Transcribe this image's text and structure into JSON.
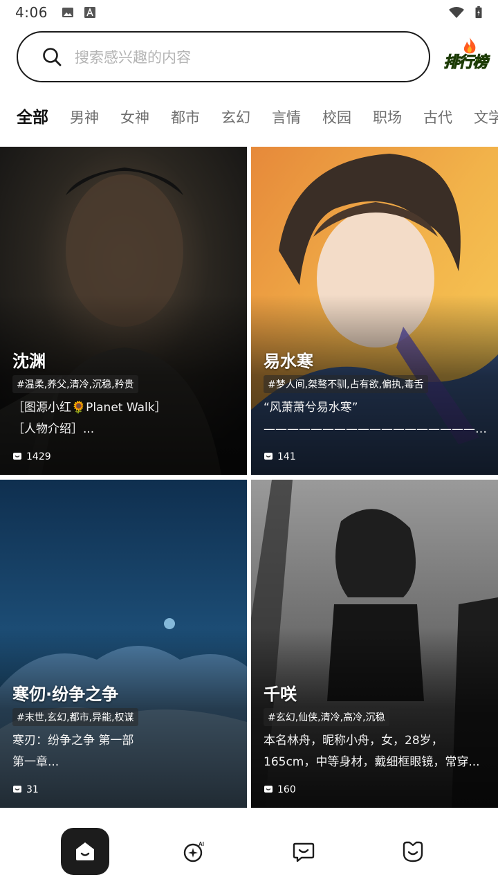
{
  "status_bar": {
    "time": "4:06",
    "icons_left": [
      "image-icon",
      "font-a-icon"
    ],
    "icons_right": [
      "wifi-icon",
      "battery-charging-icon"
    ]
  },
  "search": {
    "placeholder": "搜索感兴趣的内容",
    "icon": "search-icon"
  },
  "ranking": {
    "label": "排行榜",
    "icon": "flame-icon",
    "color": "#8bd82b"
  },
  "tabs": [
    {
      "label": "全部",
      "active": true
    },
    {
      "label": "男神",
      "active": false
    },
    {
      "label": "女神",
      "active": false
    },
    {
      "label": "都市",
      "active": false
    },
    {
      "label": "玄幻",
      "active": false
    },
    {
      "label": "言情",
      "active": false
    },
    {
      "label": "校园",
      "active": false
    },
    {
      "label": "职场",
      "active": false
    },
    {
      "label": "古代",
      "active": false
    },
    {
      "label": "文学",
      "active": false
    }
  ],
  "accent_color": "#b9ef3c",
  "cards": [
    {
      "name": "沈渊",
      "tags": "#温柔,养父,清冷,沉稳,矜贵",
      "desc_lines": [
        "［图源小红🌻Planet Walk］",
        "［人物介绍］..."
      ],
      "count": "1429"
    },
    {
      "name": "易水寒",
      "tags": "#梦人间,桀骜不驯,占有欲,偏执,毒舌",
      "desc_lines": [
        "“风萧萧兮易水寒”",
        "————————————————————..."
      ],
      "count": "141"
    },
    {
      "name": "寒仞·纷争之争",
      "tags": "#末世,玄幻,都市,异能,权谋",
      "desc_lines": [
        "寒刃：纷争之争  第一部",
        "第一章..."
      ],
      "count": "31"
    },
    {
      "name": "千咲",
      "tags": "#玄幻,仙侠,清冷,高冷,沉稳",
      "desc_lines": [
        "本名林舟，昵称小舟，女，28岁，",
        "165cm，中等身材，戴细框眼镜，常穿..."
      ],
      "count": "160"
    }
  ],
  "bottom_nav": [
    {
      "icon": "home-face-icon",
      "active": true
    },
    {
      "icon": "ai-sparkle-icon",
      "active": false
    },
    {
      "icon": "chat-bubble-icon",
      "active": false
    },
    {
      "icon": "profile-face-icon",
      "active": false
    }
  ]
}
